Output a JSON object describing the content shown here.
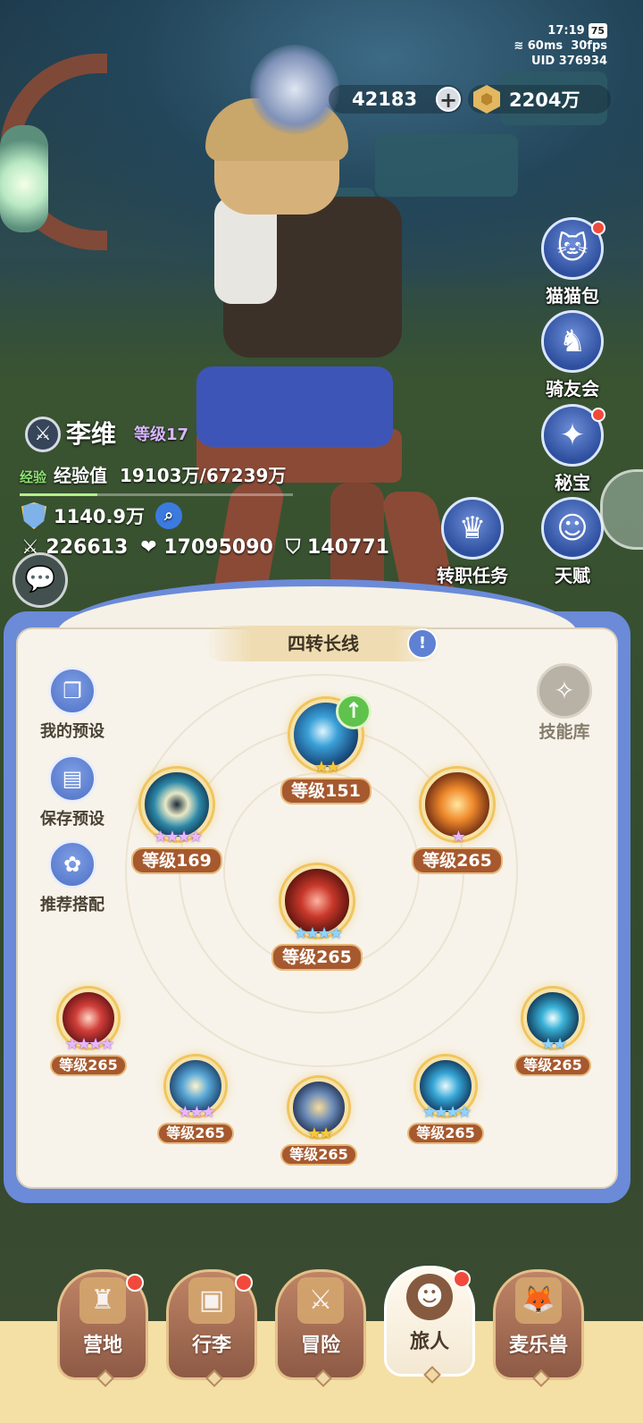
{
  "status_bar": {
    "time": "17:19",
    "battery": "75",
    "ping": "60ms",
    "fps": "30fps",
    "uid": "UID  376934"
  },
  "currency": {
    "gems": "42183",
    "gold": "2204万"
  },
  "side_menu": [
    {
      "label": "猫猫包",
      "icon": "cat-bag-icon",
      "badge": true
    },
    {
      "label": "骑友会",
      "icon": "horse-icon",
      "badge": false
    },
    {
      "label": "秘宝",
      "icon": "treasure-icon",
      "badge": true
    },
    {
      "label": "转职任务",
      "icon": "class-change-icon",
      "badge": false
    },
    {
      "label": "天赋",
      "icon": "talent-icon",
      "badge": false
    }
  ],
  "character": {
    "name": "李维",
    "level": "等级17",
    "exp_tag": "经验",
    "exp_label": "经验值",
    "exp_value": "19103万/67239万",
    "exp_fraction": 0.284,
    "power": "1140.9万",
    "attack": "226613",
    "hp": "17095090",
    "defense": "140771"
  },
  "skill_panel": {
    "title": "四转长线",
    "presets": [
      {
        "label": "我的预设",
        "icon": "preset-card-icon"
      },
      {
        "label": "保存预设",
        "icon": "save-icon"
      },
      {
        "label": "推荐搭配",
        "icon": "recommend-icon"
      }
    ],
    "library_label": "技能库",
    "skills": [
      {
        "id": "top",
        "level": "等级151",
        "stars": "★★",
        "star_color": "gold",
        "upgrade": "↑"
      },
      {
        "id": "upper-left",
        "level": "等级169",
        "stars": "★★★★",
        "star_color": "purple"
      },
      {
        "id": "upper-right",
        "level": "等级265",
        "stars": "★",
        "star_color": "purple"
      },
      {
        "id": "center",
        "level": "等级265",
        "stars": "★★★★",
        "star_color": "blue"
      },
      {
        "id": "bottom-1",
        "level": "等级265",
        "stars": "★★★★",
        "star_color": "purple"
      },
      {
        "id": "bottom-2",
        "level": "等级265",
        "stars": "★★★",
        "star_color": "purple"
      },
      {
        "id": "bottom-3",
        "level": "等级265",
        "stars": "★★",
        "star_color": "gold"
      },
      {
        "id": "bottom-4",
        "level": "等级265",
        "stars": "★★★★",
        "star_color": "blue"
      },
      {
        "id": "bottom-5",
        "level": "等级265",
        "stars": "★★",
        "star_color": "blue"
      }
    ]
  },
  "bottom_nav": [
    {
      "label": "营地",
      "icon": "castle-icon",
      "badge": true,
      "active": false
    },
    {
      "label": "行李",
      "icon": "chest-icon",
      "badge": true,
      "active": false
    },
    {
      "label": "冒险",
      "icon": "crossed-swords-icon",
      "badge": false,
      "active": false
    },
    {
      "label": "旅人",
      "icon": "traveler-portrait-icon",
      "badge": true,
      "active": true
    },
    {
      "label": "麦乐兽",
      "icon": "fox-icon",
      "badge": false,
      "active": false
    }
  ]
}
